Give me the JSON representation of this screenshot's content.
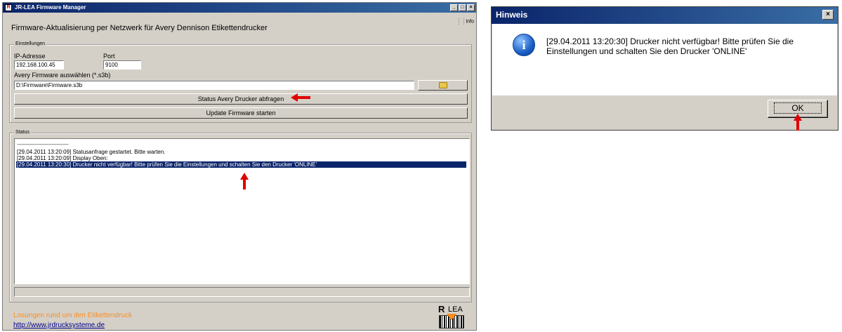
{
  "main_window": {
    "title": "JR-LEA Firmware Manager",
    "window_buttons": [
      "_",
      "□",
      "×"
    ],
    "info_label": "Info",
    "heading": "Firmware-Aktualisierung per Netzwerk für Avery Dennison Etikettendrucker",
    "settings": {
      "group_label": "Einstellungen",
      "ip_label": "IP-Adresse",
      "ip_value": "192.168.100.45",
      "port_label": "Port",
      "port_value": "9100",
      "firmware_label": "Avery Firmware auswählen (*.s3b)",
      "firmware_path": "D:\\Firmware\\Firmware.s3b",
      "status_button": "Status Avery Drucker abfragen",
      "update_button": "Update Firmware starten"
    },
    "status": {
      "group_label": "Status",
      "log": [
        "--------------------------------------------",
        "[29.04.2011 13:20:09] Statusanfrage gestartet. Bitte warten.",
        "[29.04.2011 13:20:09] Display Oben:",
        "[29.04.2011 13:20:30] Drucker nicht verfügbar! Bitte prüfen Sie die Einstellungen und schalten Sie den Drucker 'ONLINE'"
      ],
      "selected_index": 3
    },
    "footer": {
      "slogan": "Losungen rund um den Etikettendruck",
      "link": "http://www.jrdrucksysteme.de",
      "logo_text_a": "R",
      "logo_text_b": "LEA"
    }
  },
  "dialog": {
    "title": "Hinweis",
    "close": "×",
    "message": "[29.04.2011 13:20:30] Drucker nicht verfügbar! Bitte prüfen Sie die Einstellungen und schalten Sie den Drucker 'ONLINE'",
    "ok_label": "OK",
    "icon": "info-icon"
  },
  "colors": {
    "titlebar": "#0a246a",
    "face": "#d4d0c8",
    "selection": "#0a246a",
    "slogan": "#ff8c1a",
    "link": "#00008b",
    "annotation": "#e00000"
  }
}
